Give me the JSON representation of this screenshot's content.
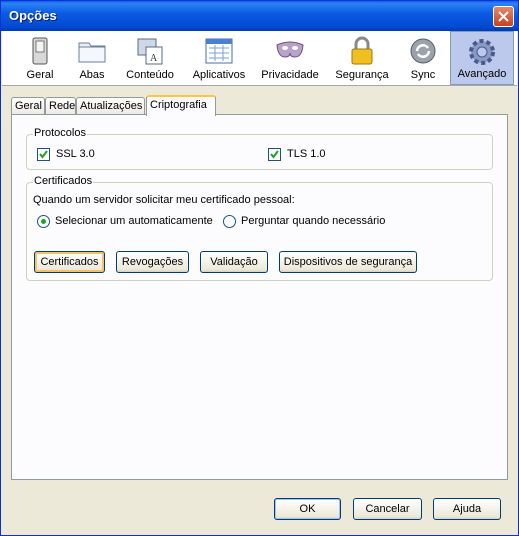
{
  "window": {
    "title": "Opções"
  },
  "toolbar": {
    "items": [
      {
        "label": "Geral",
        "icon": "switch-icon"
      },
      {
        "label": "Abas",
        "icon": "folder-tabs-icon"
      },
      {
        "label": "Conteúdo",
        "icon": "content-icon"
      },
      {
        "label": "Aplicativos",
        "icon": "applications-icon"
      },
      {
        "label": "Privacidade",
        "icon": "mask-icon"
      },
      {
        "label": "Segurança",
        "icon": "padlock-icon"
      },
      {
        "label": "Sync",
        "icon": "sync-icon"
      },
      {
        "label": "Avançado",
        "icon": "gear-icon"
      }
    ],
    "selected": "Avançado"
  },
  "subtabs": {
    "items": [
      "Geral",
      "Rede",
      "Atualizações",
      "Criptografia"
    ],
    "selected": "Criptografia"
  },
  "protocols": {
    "title": "Protocolos",
    "ssl_label": "SSL 3.0",
    "ssl_checked": true,
    "tls_label": "TLS 1.0",
    "tls_checked": true
  },
  "certificates": {
    "title": "Certificados",
    "question": "Quando um servidor solicitar meu certificado pessoal:",
    "option_auto": "Selecionar um automaticamente",
    "option_ask": "Perguntar quando necessário",
    "selected_option": "Selecionar um automaticamente",
    "btn_certificates": "Certificados",
    "btn_revocations": "Revogações",
    "btn_validation": "Validação",
    "btn_devices": "Dispositivos de segurança"
  },
  "footer": {
    "ok": "OK",
    "cancel": "Cancelar",
    "help": "Ajuda"
  },
  "colors": {
    "titlebar": "#0054e3",
    "face": "#ece9d8",
    "selected_tab_accent": "#ffc83c",
    "checkmark": "#21a121"
  }
}
